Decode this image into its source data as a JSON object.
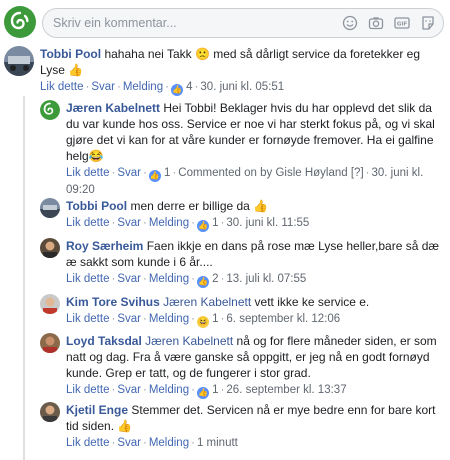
{
  "compose": {
    "placeholder": "Skriv ein kommentar..."
  },
  "comments": [
    {
      "author": "Tobbi Pool",
      "text": "hahaha nei Takk 🙁 med så dårligt service da foretekker eg Lyse 👍",
      "actions": {
        "like": "Lik dette",
        "reply": "Svar",
        "message": "Melding",
        "reaction_count": "4",
        "time": "30. juni kl. 05:51"
      }
    },
    {
      "author": "Jæren Kabelnett",
      "text": "Hei Tobbi! Beklager hvis du har opplevd det slik da du var kunde hos oss. Service er noe vi har sterkt fokus på, og vi skal gjøre det vi kan for at våre kunder er fornøyde fremover. Ha ei galfine helg😂",
      "actions": {
        "like": "Lik dette",
        "reply": "Svar",
        "reaction_count": "1",
        "commented": "Commented on by Gisle Høyland [?]",
        "time": "30. juni kl. 09:20"
      }
    },
    {
      "author": "Tobbi Pool",
      "text": "men derre er billige da 👍",
      "actions": {
        "like": "Lik dette",
        "reply": "Svar",
        "message": "Melding",
        "reaction_count": "1",
        "time": "30. juni kl. 11:55"
      }
    },
    {
      "author": "Roy Særheim",
      "text": "Faen ikkje en dans på rose mæ Lyse heller,bare så dæ æ sakkt som kunde i 6 år....",
      "actions": {
        "like": "Lik dette",
        "reply": "Svar",
        "message": "Melding",
        "reaction_count": "2",
        "time": "13. juli kl. 07:55"
      }
    },
    {
      "author": "Kim Tore Svihus",
      "tag": "Jæren Kabelnett",
      "text": "vett ikke ke service e.",
      "actions": {
        "like": "Lik dette",
        "reply": "Svar",
        "message": "Melding",
        "reaction_count": "1",
        "time": "6. september kl. 12:06"
      }
    },
    {
      "author": "Loyd Taksdal",
      "tag": "Jæren Kabelnett",
      "text": "nå og for flere måneder siden, er som natt og dag. Fra å være ganske så oppgitt, er jeg nå en godt fornøyd kunde. Grep er tatt, og de fungerer i stor grad.",
      "actions": {
        "like": "Lik dette",
        "reply": "Svar",
        "message": "Melding",
        "reaction_count": "1",
        "time": "26. september kl. 13:37"
      }
    },
    {
      "author": "Kjetil Enge",
      "text": "Stemmer det. Servicen nå er mye bedre enn for bare kort tid siden. 👍",
      "actions": {
        "like": "Lik dette",
        "reply": "Svar",
        "message": "Melding",
        "time": "1 minutt"
      }
    }
  ],
  "colors": {
    "link": "#385898",
    "action_link": "#4267b2",
    "brand_green": "#3c9a3a",
    "like_blue": "#5890ff"
  }
}
